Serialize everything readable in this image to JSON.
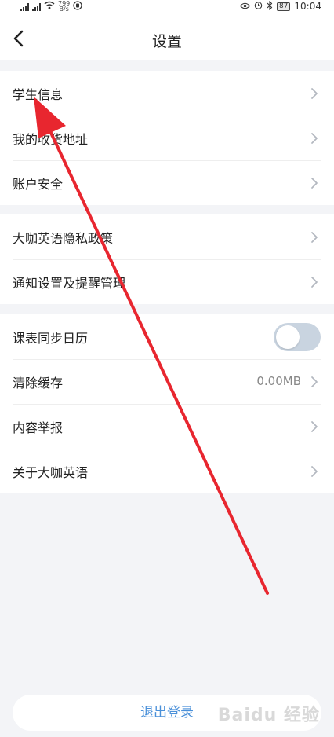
{
  "status_bar": {
    "speed": "799",
    "speed_unit": "B/s",
    "battery": "87",
    "time": "10:04"
  },
  "header": {
    "title": "设置"
  },
  "groups": [
    {
      "items": [
        {
          "label": "学生信息",
          "icon": "chevron-right-icon"
        },
        {
          "label": "我的收货地址",
          "icon": "chevron-right-icon"
        },
        {
          "label": "账户安全",
          "icon": "chevron-right-icon"
        }
      ]
    },
    {
      "items": [
        {
          "label": "大咖英语隐私政策",
          "icon": "chevron-right-icon"
        },
        {
          "label": "通知设置及提醒管理",
          "icon": "chevron-right-icon"
        }
      ]
    },
    {
      "items": [
        {
          "label": "课表同步日历",
          "toggle": "off"
        },
        {
          "label": "清除缓存",
          "value": "0.00MB",
          "icon": "chevron-right-icon"
        },
        {
          "label": "内容举报",
          "icon": "chevron-right-icon"
        },
        {
          "label": "关于大咖英语",
          "icon": "chevron-right-icon"
        }
      ]
    }
  ],
  "footer": {
    "logout_label": "退出登录"
  },
  "overlay": {
    "arrow_color": "#e8262f",
    "watermark": "Baidu 经验"
  },
  "colors": {
    "accent": "#4a90d9",
    "background": "#f3f4f7",
    "toggle_off": "#c9d4e0"
  }
}
